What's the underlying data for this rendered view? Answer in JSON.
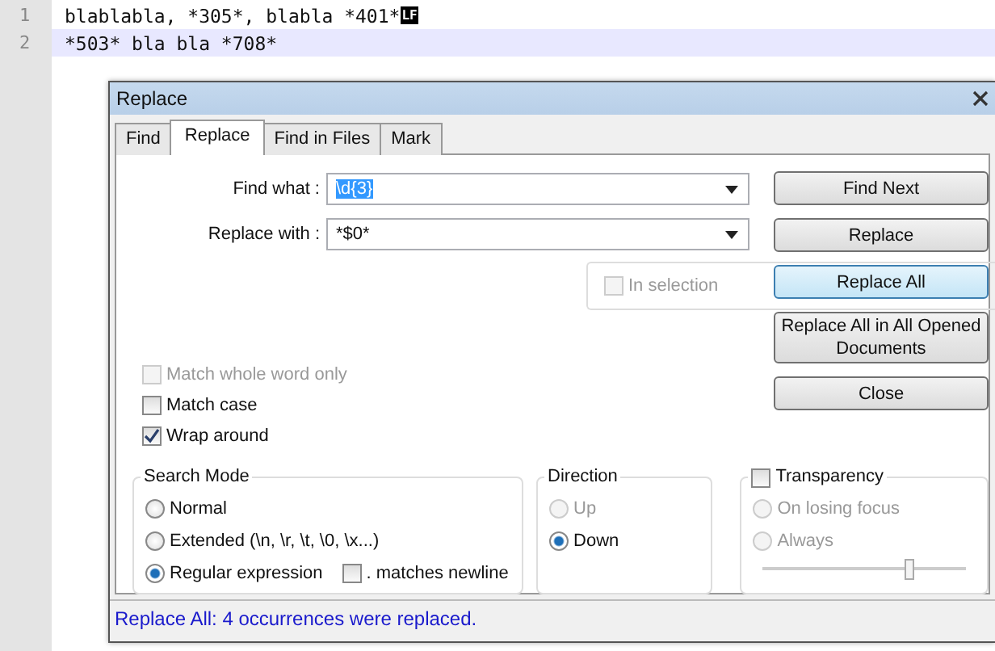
{
  "editor": {
    "lines": [
      {
        "number": "1",
        "text": "blablabla, *305*, blabla *401*",
        "eol": "LF",
        "current": false
      },
      {
        "number": "2",
        "text": "*503* bla bla *708*",
        "current": true
      }
    ]
  },
  "dialog": {
    "title": "Replace",
    "tabs": [
      {
        "label": "Find",
        "selected": false
      },
      {
        "label": "Replace",
        "selected": true
      },
      {
        "label": "Find in Files",
        "selected": false
      },
      {
        "label": "Mark",
        "selected": false
      }
    ],
    "find_what": {
      "label": "Find what :",
      "value": "\\d{3}",
      "highlighted": true
    },
    "replace_with": {
      "label": "Replace with :",
      "value": "*$0*",
      "highlighted": false
    },
    "in_selection": {
      "label": "In selection",
      "checked": false,
      "disabled": true
    },
    "options": [
      {
        "label": "Match whole word only",
        "checked": false,
        "disabled": true
      },
      {
        "label": "Match case",
        "checked": false,
        "disabled": false
      },
      {
        "label": "Wrap around",
        "checked": true,
        "disabled": false
      }
    ],
    "buttons": [
      {
        "label": "Find Next",
        "focused": false
      },
      {
        "label": "Replace",
        "focused": false
      },
      {
        "label": "Replace All",
        "focused": true
      },
      {
        "label": "Replace All in All Opened Documents",
        "focused": false
      },
      {
        "label": "Close",
        "focused": false
      }
    ],
    "search_mode": {
      "title": "Search Mode",
      "options": [
        {
          "label": "Normal",
          "selected": false
        },
        {
          "label": "Extended (\\n, \\r, \\t, \\0, \\x...)",
          "selected": false
        },
        {
          "label": "Regular expression",
          "selected": true
        }
      ],
      "matches_newline": {
        "label": ". matches newline",
        "checked": false
      }
    },
    "direction": {
      "title": "Direction",
      "options": [
        {
          "label": "Up",
          "selected": false,
          "disabled": true
        },
        {
          "label": "Down",
          "selected": true,
          "disabled": false
        }
      ]
    },
    "transparency": {
      "label": "Transparency",
      "checked": false,
      "options": [
        {
          "label": "On losing focus",
          "selected": false
        },
        {
          "label": "Always",
          "selected": false
        }
      ],
      "level": 0.72
    },
    "status": "Replace All: 4 occurrences were replaced."
  }
}
